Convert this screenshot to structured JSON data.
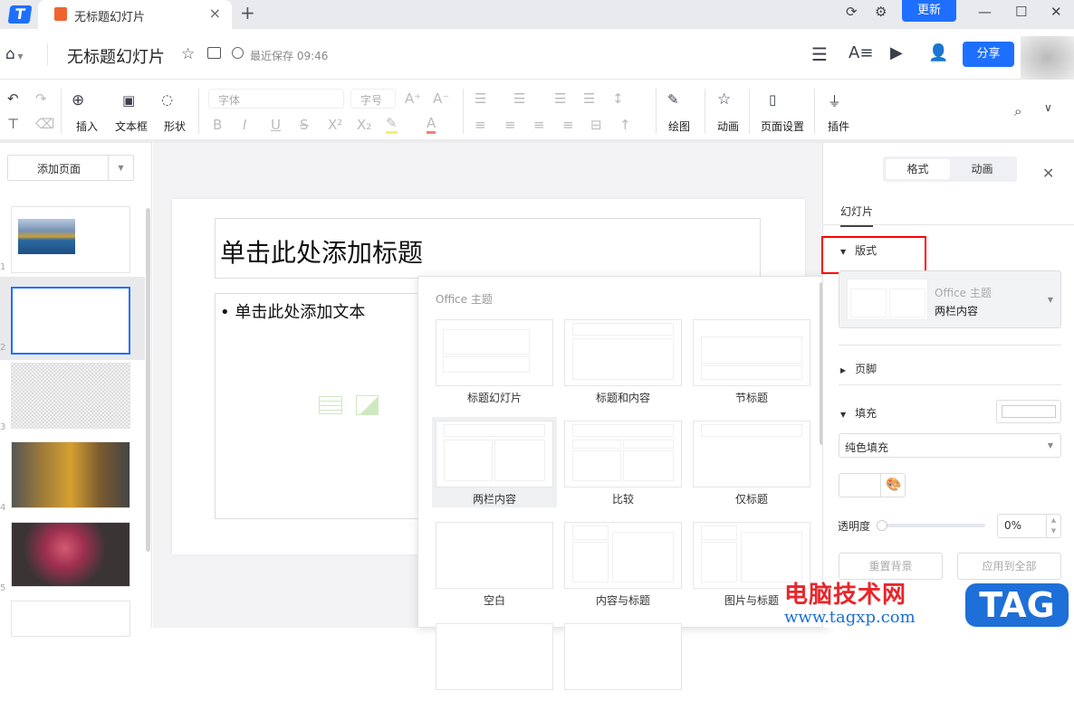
{
  "tabbar": {
    "tab_title": "无标题幻灯片",
    "update_label": "更新"
  },
  "header": {
    "doc_title": "无标题幻灯片",
    "save_status": "最近保存 09:46",
    "share_label": "分享"
  },
  "toolbar": {
    "insert": "插入",
    "textbox": "文本框",
    "shape": "形状",
    "font_placeholder": "字体",
    "size_placeholder": "字号",
    "draw": "绘图",
    "animation": "动画",
    "page_setup": "页面设置",
    "plugin": "插件"
  },
  "left": {
    "add_page": "添加页面",
    "slides": [
      "1",
      "2",
      "3",
      "4",
      "5"
    ]
  },
  "slide": {
    "title_placeholder": "单击此处添加标题",
    "body_placeholder": "• 单击此处添加文本"
  },
  "layout_popup": {
    "heading": "Office 主题",
    "layouts": [
      "标题幻灯片",
      "标题和内容",
      "节标题",
      "两栏内容",
      "比较",
      "仅标题",
      "空白",
      "内容与标题",
      "图片与标题"
    ],
    "selected": "两栏内容"
  },
  "right": {
    "tab_format": "格式",
    "tab_animation": "动画",
    "subtab": "幻灯片",
    "layout_section": "版式",
    "theme_name": "Office 主题",
    "layout_name": "两栏内容",
    "footer_section": "页脚",
    "fill_section": "填充",
    "fill_type": "纯色填充",
    "transparency_label": "透明度",
    "transparency_value": "0%",
    "reset_bg": "重置背景",
    "apply_all": "应用到全部"
  },
  "watermark": {
    "site_name": "电脑技术网",
    "url": "www.tagxp.com",
    "logo": "TAG"
  },
  "colors": {
    "accent": "#1f6fff",
    "highlight_box": "#ff0000"
  }
}
